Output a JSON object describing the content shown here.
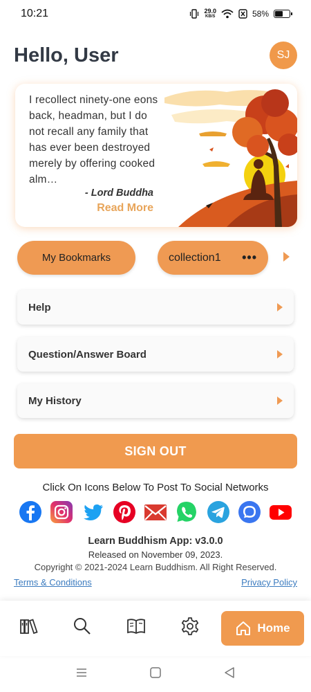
{
  "status_bar": {
    "time": "10:21",
    "net_speed_value": "29.0",
    "net_speed_unit": "KB/S",
    "battery": "58%",
    "battery_level": 0.58
  },
  "header": {
    "greeting": "Hello, User",
    "avatar_initials": "SJ"
  },
  "quote_card": {
    "text": "I recollect ninety-one eons back, headman, but I do not recall any family that has ever been destroyed merely by offering cooked alm…",
    "author": "- Lord Buddha",
    "read_more": "Read More"
  },
  "pills": {
    "bookmarks": "My Bookmarks",
    "collection": "collection1",
    "collection_more": "•••"
  },
  "menu": [
    {
      "label": "Help"
    },
    {
      "label": "Question/Answer Board"
    },
    {
      "label": "My History"
    }
  ],
  "sign_out": "SIGN OUT",
  "social": {
    "title": "Click On Icons Below To Post To Social Networks",
    "icons": [
      "facebook-icon",
      "instagram-icon",
      "twitter-icon",
      "pinterest-icon",
      "email-icon",
      "whatsapp-icon",
      "telegram-icon",
      "signal-icon",
      "youtube-icon"
    ]
  },
  "footer": {
    "app_version": "Learn Buddhism App: v3.0.0",
    "released": "Released on November 09, 2023.",
    "copyright": "Copyright ©  2021-2024 Learn Buddhism. All Right Reserved.",
    "terms": "Terms & Conditions",
    "privacy": "Privacy Policy"
  },
  "bottom_nav": {
    "items": [
      "library-icon",
      "search-icon",
      "book-icon",
      "settings-icon"
    ],
    "home_label": "Home"
  },
  "colors": {
    "accent": "#f09a4f",
    "link": "#3b7bbf",
    "title": "#333a45"
  }
}
